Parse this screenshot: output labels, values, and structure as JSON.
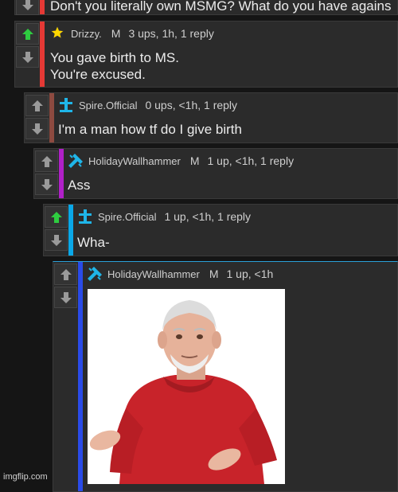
{
  "comments": [
    {
      "body": "Don't you literally own MSMG? What do you have agains",
      "bar_color": "#e53935"
    },
    {
      "user": "Drizzy.",
      "mod": "M",
      "stats": "3 ups, 1h, 1 reply",
      "body": "You gave birth to MS.\nYou're excused.",
      "bar_color": "#e53935",
      "avatar_icon": "star-icon",
      "upvoted": true
    },
    {
      "user": "Spire.Official",
      "mod": "",
      "stats": "0 ups, <1h, 1 reply",
      "body": "I'm a man how tf do I give birth",
      "bar_color": "#8d4a40",
      "avatar_icon": "cross-icon",
      "upvoted": false
    },
    {
      "user": "HolidayWallhammer",
      "mod": "M",
      "stats": "1 up, <1h, 1 reply",
      "body": "Ass",
      "bar_color": "#b020c8",
      "avatar_icon": "hammer-icon",
      "upvoted": false
    },
    {
      "user": "Spire.Official",
      "mod": "",
      "stats": "1 up, <1h, 1 reply",
      "body": "Wha-",
      "bar_color": "#0aa8e8",
      "avatar_icon": "cross-icon",
      "upvoted": true
    },
    {
      "user": "HolidayWallhammer",
      "mod": "M",
      "stats": "1 up, <1h",
      "body": "",
      "bar_color": "#2a4be8",
      "avatar_icon": "hammer-icon",
      "upvoted": false,
      "image": "shrugging-old-man-meme"
    }
  ],
  "watermark": "imgflip.com",
  "colors": {
    "upvote_active": "#2ecc40",
    "vote_inactive": "#9a9a9a",
    "cyan_icon": "#1fb5e8"
  }
}
